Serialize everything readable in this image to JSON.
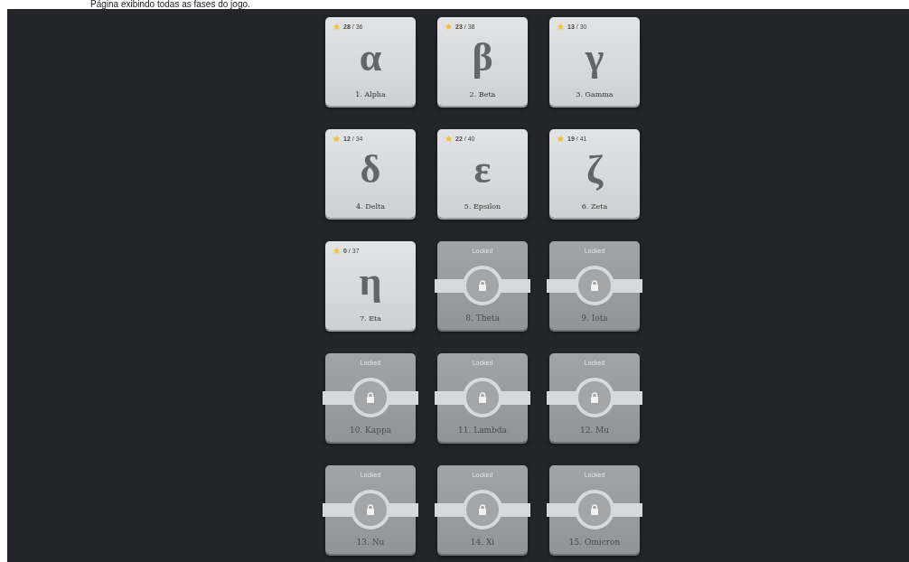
{
  "caption": "Página exibindo todas as fases do jogo.",
  "levels": [
    {
      "name": "1. Alpha",
      "symbol": "α",
      "score": "**28** / 36",
      "locked": false
    },
    {
      "name": "2. Beta",
      "symbol": "β",
      "score": "**23** / 38",
      "locked": false
    },
    {
      "name": "3. Gamma",
      "symbol": "γ",
      "score": "**13** / 30",
      "locked": false
    },
    {
      "name": "4. Delta",
      "symbol": "δ",
      "score": "**12** / 34",
      "locked": false
    },
    {
      "name": "5. Epsilon",
      "symbol": "ε",
      "score": "**22** / 40",
      "locked": false
    },
    {
      "name": "6. Zeta",
      "symbol": "ζ",
      "score": "**19** / 41",
      "locked": false
    },
    {
      "name": "7. Eta",
      "symbol": "η",
      "score": "**0** / 37",
      "locked": false
    },
    {
      "name": "8. Theta",
      "status": "Locked",
      "locked": true
    },
    {
      "name": "9. Iota",
      "status": "Locked",
      "locked": true
    },
    {
      "name": "10. Kappa",
      "status": "Locked",
      "locked": true
    },
    {
      "name": "11. Lambda",
      "status": "Locked",
      "locked": true
    },
    {
      "name": "12. Mu",
      "status": "Locked",
      "locked": true
    },
    {
      "name": "13. Nu",
      "status": "Locked",
      "locked": true
    },
    {
      "name": "14. Xi",
      "status": "Locked",
      "locked": true
    },
    {
      "name": "15. Omicron",
      "status": "Locked",
      "locked": true
    }
  ]
}
